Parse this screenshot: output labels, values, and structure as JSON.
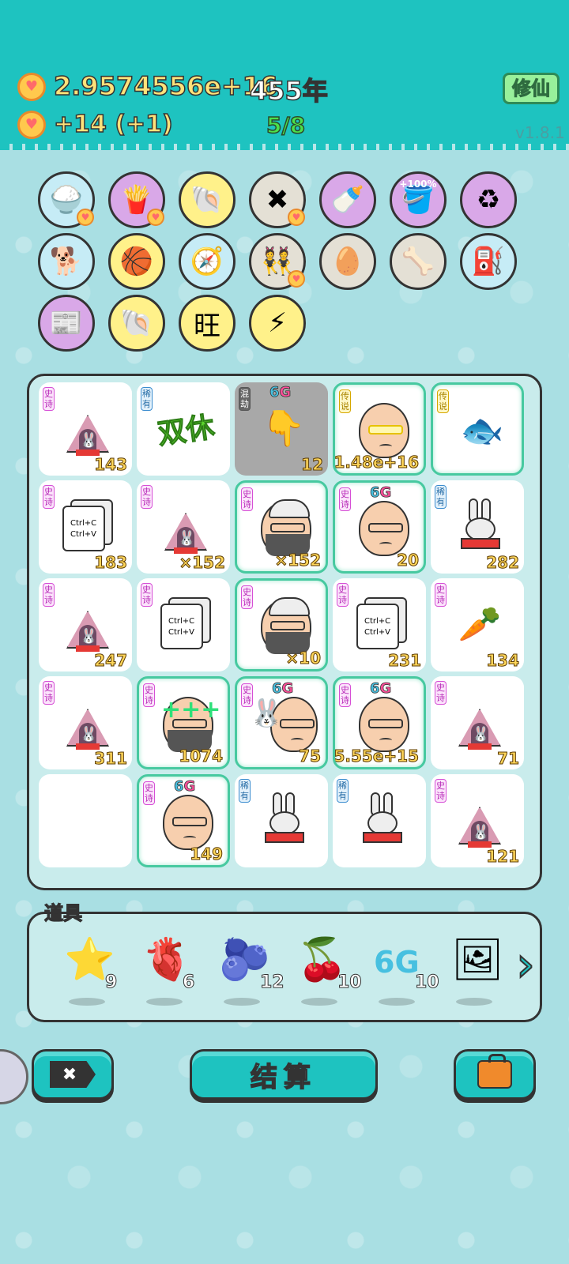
{
  "header": {
    "money": "2.9574556e+16",
    "years": "455年",
    "income": "+14   (+1)",
    "progress": "5/8",
    "cultivate_label": "修仙",
    "version": "v1.8.1",
    "heart_glyph": "♥"
  },
  "icon_row1": [
    {
      "name": "rice-bowl-icon",
      "glyph": "🍚",
      "bg": "blue",
      "badge": true
    },
    {
      "name": "fries-icon",
      "glyph": "🍟",
      "bg": "purple",
      "badge": true
    },
    {
      "name": "shell-icon",
      "glyph": "🐚",
      "bg": "yellow",
      "badge": false
    },
    {
      "name": "delete-tag-icon",
      "glyph": "✖",
      "bg": "grey",
      "badge": true
    },
    {
      "name": "breast-pump-icon",
      "glyph": "🍼",
      "bg": "purple",
      "badge": false
    },
    {
      "name": "bucket-bonus-icon",
      "glyph": "🪣",
      "bg": "purple",
      "badge": false,
      "caption": "+100%"
    },
    {
      "name": "recycle-icon",
      "glyph": "♻",
      "bg": "purple",
      "badge": false
    }
  ],
  "icon_row2": [
    {
      "name": "cool-dog-icon",
      "glyph": "🐕",
      "bg": "blue"
    },
    {
      "name": "basketballs-icon",
      "glyph": "🏀",
      "bg": "yellow"
    },
    {
      "name": "compass-icon",
      "glyph": "🧭",
      "bg": "blue"
    },
    {
      "name": "twins-icon",
      "glyph": "👯",
      "bg": "grey",
      "badge": true
    },
    {
      "name": "egg-tray-icon",
      "glyph": "🥚",
      "bg": "grey"
    },
    {
      "name": "dog-bowl-icon",
      "glyph": "🦴",
      "bg": "grey"
    },
    {
      "name": "air-pump-icon",
      "glyph": "⛽",
      "bg": "blue"
    }
  ],
  "icon_row3": [
    {
      "name": "time-magazine-icon",
      "glyph": "📰",
      "bg": "purple"
    },
    {
      "name": "shell-icon",
      "glyph": "🐚",
      "bg": "yellow"
    },
    {
      "name": "wang-characters-icon",
      "glyph": "旺",
      "bg": "yellow"
    },
    {
      "name": "lightning-icon",
      "glyph": "⚡",
      "bg": "yellow"
    }
  ],
  "board": {
    "tags": {
      "epic": "史诗",
      "rare": "稀有",
      "legend": "传说",
      "chaos": "混劫"
    },
    "ctrl_text": "Ctrl+C\nCtrl+V",
    "shuangxiu": "双休",
    "g6": "6",
    "g_letter": "G",
    "cells": [
      {
        "r": 0,
        "c": 0,
        "tag": "epic",
        "art": "tent",
        "count": "143"
      },
      {
        "r": 0,
        "c": 1,
        "tag": "rare",
        "art": "shuangxiu",
        "count": ""
      },
      {
        "r": 0,
        "c": 2,
        "tag": "chaos",
        "art": "hand",
        "count": "12",
        "dark": true,
        "g6": true
      },
      {
        "r": 0,
        "c": 3,
        "tag": "legend",
        "art": "face-gold",
        "count": "1.48e+16",
        "glow": true
      },
      {
        "r": 0,
        "c": 4,
        "tag": "legend",
        "art": "fish",
        "count": "",
        "glow": true
      },
      {
        "r": 1,
        "c": 0,
        "tag": "epic",
        "art": "ctrl",
        "count": "183"
      },
      {
        "r": 1,
        "c": 1,
        "tag": "epic",
        "art": "tent",
        "count": "×152"
      },
      {
        "r": 1,
        "c": 2,
        "tag": "epic",
        "art": "face-beard-hat",
        "count": "×152",
        "glow": true
      },
      {
        "r": 1,
        "c": 3,
        "tag": "epic",
        "art": "face",
        "count": "20",
        "glow": true,
        "g6": true
      },
      {
        "r": 1,
        "c": 4,
        "tag": "rare",
        "art": "rabbit",
        "count": "282"
      },
      {
        "r": 2,
        "c": 0,
        "tag": "epic",
        "art": "tent",
        "count": "247"
      },
      {
        "r": 2,
        "c": 1,
        "tag": "epic",
        "art": "ctrl",
        "count": ""
      },
      {
        "r": 2,
        "c": 2,
        "tag": "epic",
        "art": "face-beard-hat",
        "count": "×10",
        "glow": true
      },
      {
        "r": 2,
        "c": 3,
        "tag": "epic",
        "art": "ctrl",
        "count": "231"
      },
      {
        "r": 2,
        "c": 4,
        "tag": "epic",
        "art": "carrot",
        "count": "134"
      },
      {
        "r": 3,
        "c": 0,
        "tag": "epic",
        "art": "tent",
        "count": "311"
      },
      {
        "r": 3,
        "c": 1,
        "tag": "epic",
        "art": "face-plus",
        "count": "1074",
        "glow": true
      },
      {
        "r": 3,
        "c": 2,
        "tag": "epic",
        "art": "face-rabbit",
        "count": "75",
        "glow": true,
        "g6": true
      },
      {
        "r": 3,
        "c": 3,
        "tag": "epic",
        "art": "face",
        "count": "5.55e+15",
        "glow": true,
        "g6": true
      },
      {
        "r": 3,
        "c": 4,
        "tag": "epic",
        "art": "tent",
        "count": "71"
      },
      {
        "r": 4,
        "c": 0,
        "tag": "",
        "art": "",
        "count": ""
      },
      {
        "r": 4,
        "c": 1,
        "tag": "epic",
        "art": "face",
        "count": "149",
        "glow": true,
        "g6": true
      },
      {
        "r": 4,
        "c": 2,
        "tag": "rare",
        "art": "rabbit",
        "count": ""
      },
      {
        "r": 4,
        "c": 3,
        "tag": "rare",
        "art": "rabbit",
        "count": ""
      },
      {
        "r": 4,
        "c": 4,
        "tag": "epic",
        "art": "tent",
        "count": "121"
      }
    ]
  },
  "tools": {
    "label": "道具",
    "items": [
      {
        "name": "star-tool",
        "glyph": "⭐",
        "count": "9"
      },
      {
        "name": "liver-tool",
        "glyph": "🫀",
        "count": "6"
      },
      {
        "name": "blueberry-tool",
        "glyph": "🫐",
        "count": "12"
      },
      {
        "name": "lychee-tool",
        "glyph": "🍒",
        "count": "10"
      },
      {
        "name": "6g-tool",
        "glyph": "6G",
        "count": "10"
      },
      {
        "name": "portrait-tool",
        "glyph": "🖼",
        "count": ""
      }
    ],
    "next_glyph": "›"
  },
  "buttons": {
    "delete_glyph": "✖",
    "settle_label": "结算"
  }
}
